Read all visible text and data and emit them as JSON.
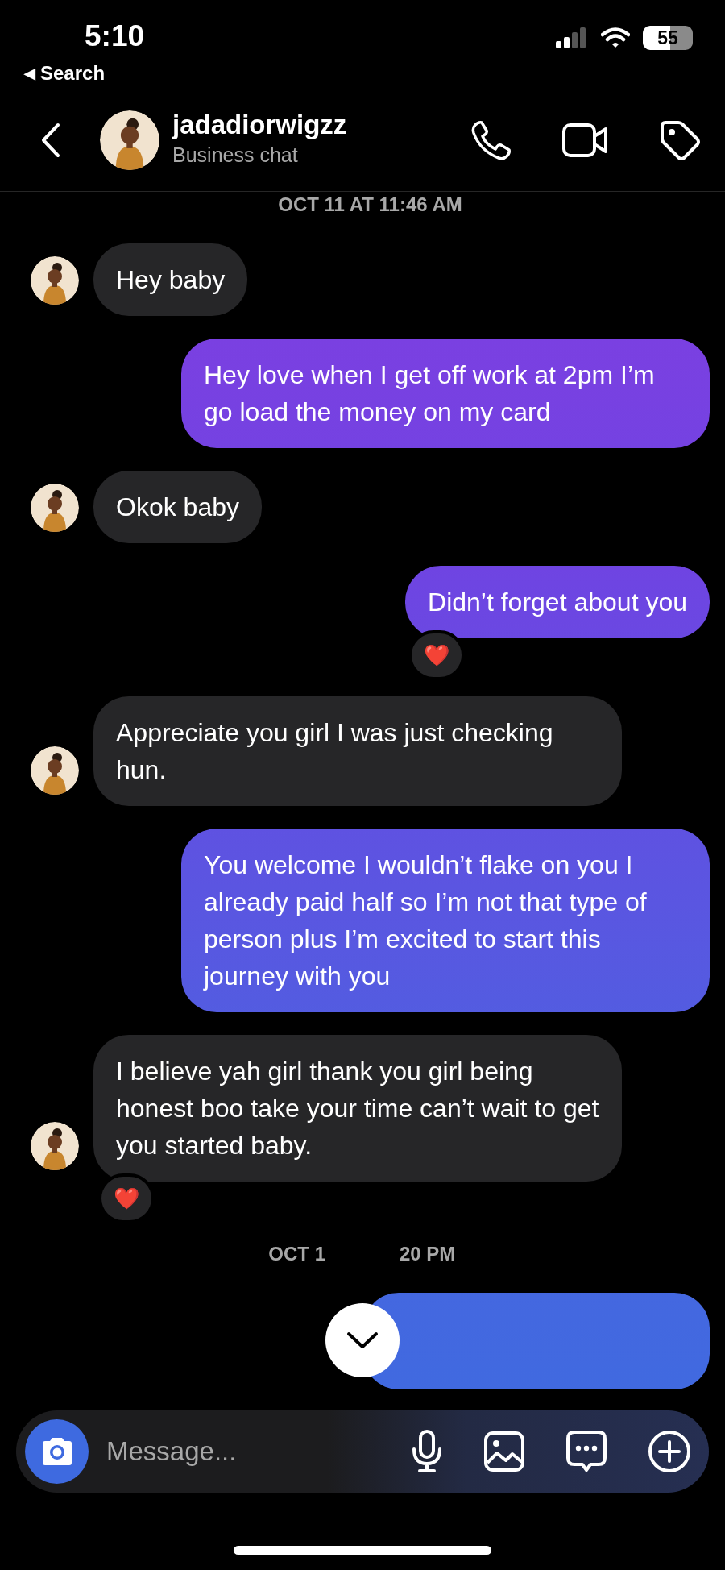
{
  "status_bar": {
    "time": "5:10",
    "back_arrow": "◀",
    "back_label": "Search",
    "battery": "55"
  },
  "header": {
    "username": "jadadiorwigzz",
    "subtitle": "Business chat"
  },
  "thread": [
    {
      "kind": "timestamp",
      "text": "OCT 11 AT 11:46 AM"
    },
    {
      "kind": "received",
      "text": "Hey baby"
    },
    {
      "kind": "sent",
      "text": "Hey love when I get off work at 2pm I’m go load the money on my card"
    },
    {
      "kind": "received",
      "text": "Okok baby"
    },
    {
      "kind": "sent",
      "text": "Didn’t forget about you",
      "reaction": "❤️"
    },
    {
      "kind": "received",
      "text": "Appreciate you girl I was just checking hun."
    },
    {
      "kind": "sent",
      "text": "You welcome I wouldn’t flake on you I already paid half so I’m not that type of person plus I’m excited to start this journey with you"
    },
    {
      "kind": "received",
      "text": "I believe yah girl thank you girl being honest boo take your time can’t wait to get you started baby.",
      "reaction": "❤️"
    },
    {
      "kind": "timestamp_split",
      "parts": [
        "OCT 1",
        "20 PM"
      ]
    },
    {
      "kind": "sent_hidden"
    }
  ],
  "composer": {
    "placeholder": "Message..."
  }
}
